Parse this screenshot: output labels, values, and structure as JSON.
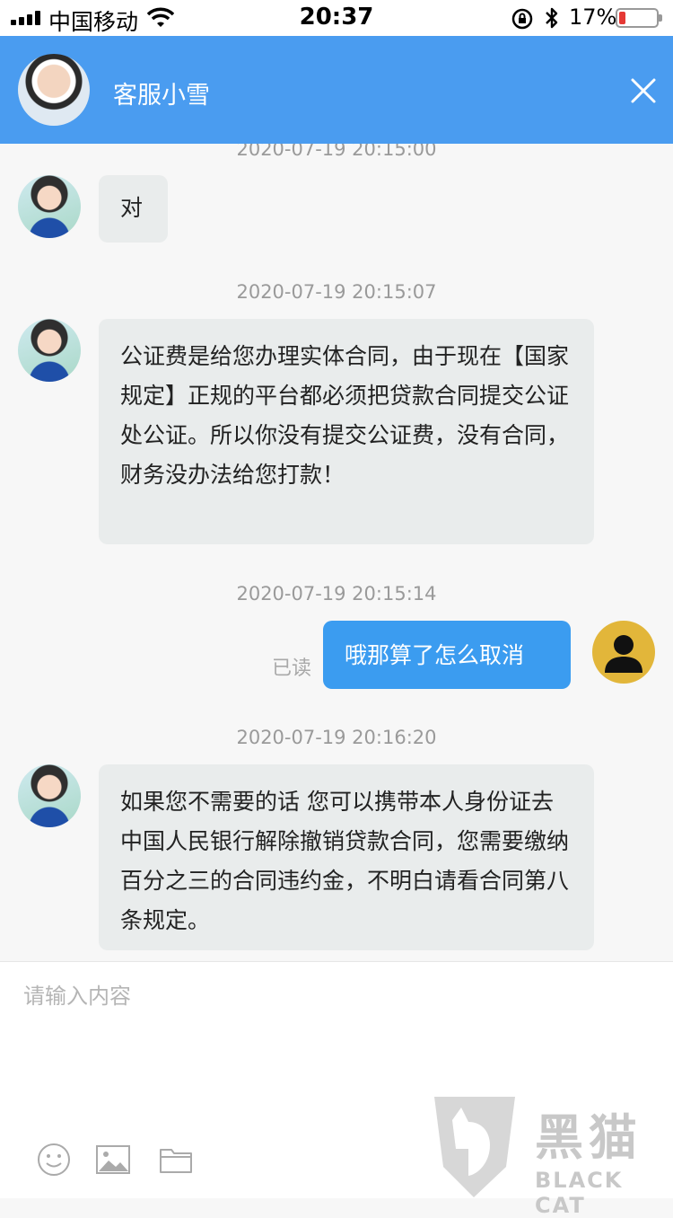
{
  "status_bar": {
    "carrier": "中国移动",
    "time": "20:37",
    "battery_pct": "17%",
    "battery_level": 0.17
  },
  "header": {
    "title": "客服小雪"
  },
  "messages": [
    {
      "type": "timestamp",
      "text": "2020-07-19 20:15:00"
    },
    {
      "type": "in",
      "text": "对"
    },
    {
      "type": "timestamp",
      "text": "2020-07-19 20:15:07"
    },
    {
      "type": "in",
      "text": "公证费是给您办理实体合同，由于现在【国家规定】正规的平台都必须把贷款合同提交公证处公证。所以你没有提交公证费，没有合同，财务没办法给您打款！"
    },
    {
      "type": "timestamp",
      "text": "2020-07-19 20:15:14"
    },
    {
      "type": "out",
      "text": "哦那算了怎么取消",
      "status": "已读"
    },
    {
      "type": "timestamp",
      "text": "2020-07-19 20:16:20"
    },
    {
      "type": "in",
      "text": "如果您不需要的话 您可以携带本人身份证去中国人民银行解除撤销贷款合同，您需要缴纳百分之三的合同违约金，不明白请看合同第八条规定。"
    }
  ],
  "input": {
    "placeholder": "请输入内容"
  },
  "toolbar": {
    "icons": [
      "smile-icon",
      "image-icon",
      "folder-icon"
    ]
  },
  "watermark": {
    "cn": "黑猫",
    "en": "BLACK CAT"
  },
  "colors": {
    "header_bg": "#4a9cf0",
    "outgoing_bubble": "#3b9cf0",
    "incoming_bubble": "#e9ecec"
  }
}
